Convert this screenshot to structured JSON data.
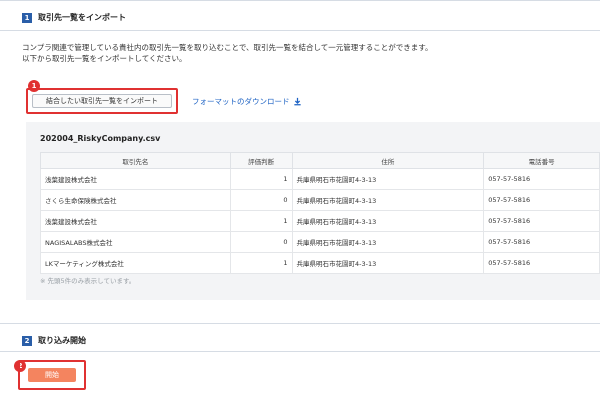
{
  "section1": {
    "number": "1",
    "title": "取引先一覧をインポート",
    "description_lines": [
      "コンプラ関連で管理している貴社内の取引先一覧を取り込むことで、取引先一覧を結合して一元管理することができます。",
      "以下から取引先一覧をインポートしてください。"
    ],
    "import_button": "結合したい取引先一覧をインポート",
    "download_link": "フォーマットのダウンロード",
    "step_badge": "1"
  },
  "preview": {
    "filename": "202004_RiskyCompany.csv",
    "columns": [
      "取引先名",
      "評価判断",
      "住所",
      "電話番号"
    ],
    "rows": [
      [
        "浅葉建設株式会社",
        "1",
        "兵庫県明石市花園町4-3-13",
        "057-57-5816"
      ],
      [
        "さくら生命保険株式会社",
        "0",
        "兵庫県明石市花園町4-3-13",
        "057-57-5816"
      ],
      [
        "浅葉建設株式会社",
        "1",
        "兵庫県明石市花園町4-3-13",
        "057-57-5816"
      ],
      [
        "NAGISALABS株式会社",
        "0",
        "兵庫県明石市花園町4-3-13",
        "057-57-5816"
      ],
      [
        "LKマーケティング株式会社",
        "1",
        "兵庫県明石市花園町4-3-13",
        "057-57-5816"
      ]
    ],
    "note": "※ 先頭5件のみ表示しています。"
  },
  "section2": {
    "number": "2",
    "title": "取り込み開始",
    "start_button": "開始",
    "step_badge": "2"
  },
  "colors": {
    "accent_blue": "#2a5ea8",
    "link_blue": "#1e63c4",
    "highlight_red": "#e03131",
    "start_orange": "#f4845f"
  }
}
